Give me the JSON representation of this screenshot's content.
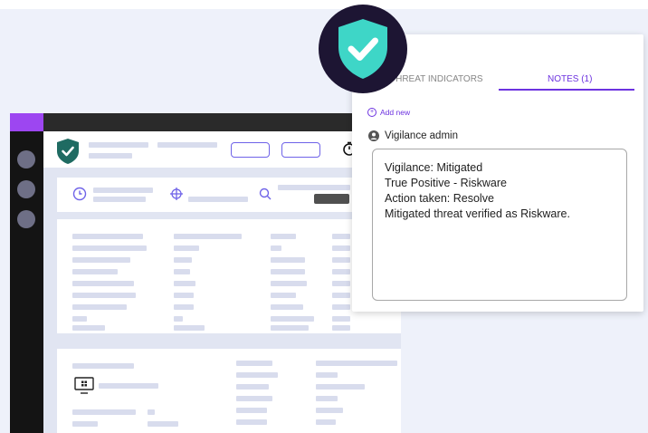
{
  "popup": {
    "tabs": [
      {
        "label": "THREAT INDICATORS",
        "active": false
      },
      {
        "label": "NOTES (1)",
        "active": true
      }
    ],
    "add_new_label": "Add new",
    "author": "Vigilance admin",
    "note_lines": [
      "Vigilance: Mitigated",
      "True Positive - Riskware",
      "Action taken: Resolve",
      "Mitigated threat verified as Riskware."
    ]
  },
  "icons": {
    "badge": "shield-check-icon",
    "app_logo": "shield-check-icon",
    "header_action": "timer-icon",
    "summary": [
      "clock-icon",
      "crosshair-icon",
      "search-icon"
    ],
    "endpoint": "windows-monitor-icon",
    "add_new": "plus-circle-icon",
    "author": "user-circle-icon"
  },
  "colors": {
    "accent_purple": "#6d33e0",
    "shield_teal": "#3ed6c7",
    "badge_navy": "#1d1533",
    "sidebar_dark": "#141414"
  }
}
